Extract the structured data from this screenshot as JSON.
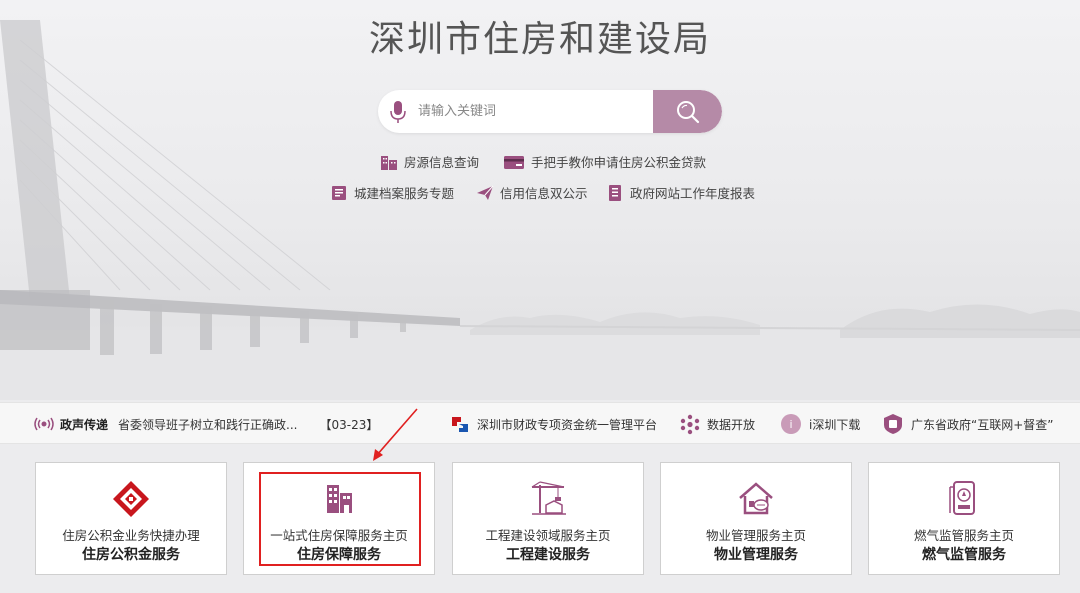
{
  "site": {
    "title": "深圳市住房和建设局"
  },
  "search": {
    "placeholder": "请输入关键词"
  },
  "quick_links": [
    {
      "label": "房源信息查询",
      "icon": "building-icon"
    },
    {
      "label": "手把手教你申请住房公积金贷款",
      "icon": "card-icon"
    },
    {
      "label": "城建档案服务专题",
      "icon": "archive-icon"
    },
    {
      "label": "信用信息双公示",
      "icon": "paper-plane-icon"
    },
    {
      "label": "政府网站工作年度报表",
      "icon": "report-icon"
    }
  ],
  "news": {
    "label": "政声传递",
    "headline": "省委领导班子树立和践行正确政...",
    "date": "【03-23】"
  },
  "links": [
    {
      "label": "深圳市财政专项资金统一管理平台",
      "icon": "finance-platform-icon"
    },
    {
      "label": "数据开放",
      "icon": "data-open-icon"
    },
    {
      "label": "i深圳下载",
      "icon": "i-shenzhen-icon"
    },
    {
      "label": "广东省政府“互联网+督查”",
      "icon": "supervision-icon"
    }
  ],
  "services": [
    {
      "sub": "住房公积金业务快捷办理",
      "main": "住房公积金服务",
      "icon": "housing-fund-icon"
    },
    {
      "sub": "一站式住房保障服务主页",
      "main": "住房保障服务",
      "icon": "housing-security-icon"
    },
    {
      "sub": "工程建设领域服务主页",
      "main": "工程建设服务",
      "icon": "construction-crane-icon"
    },
    {
      "sub": "物业管理服务主页",
      "main": "物业管理服务",
      "icon": "property-house-icon"
    },
    {
      "sub": "燃气监管服务主页",
      "main": "燃气监管服务",
      "icon": "gas-meter-icon"
    }
  ],
  "colors": {
    "accent": "#9a4f7f",
    "search_button": "#b58aa7",
    "highlight": "#e02020",
    "brand_red": "#c8161d"
  }
}
